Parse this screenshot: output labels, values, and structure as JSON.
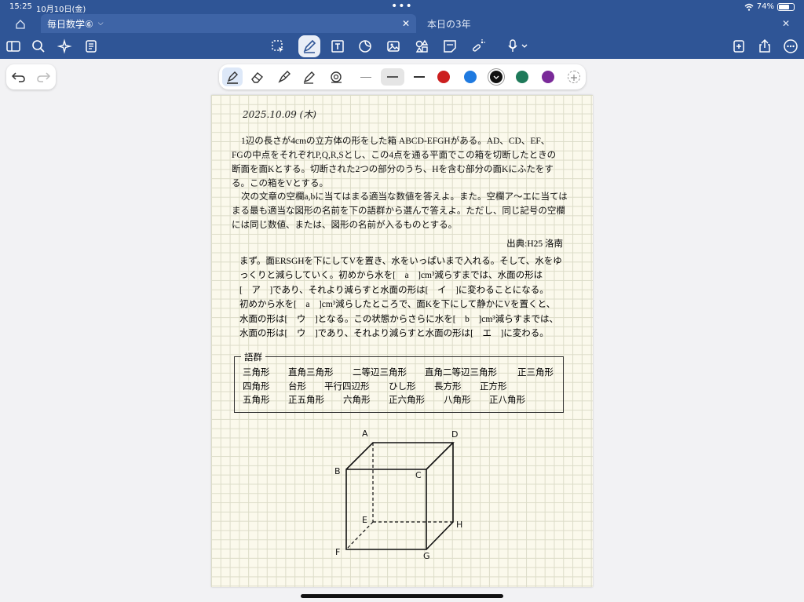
{
  "status": {
    "time": "15:25",
    "date": "10月10日(金)",
    "battery": "74%",
    "battery_level": 0.74
  },
  "tabs": [
    {
      "label": "毎日数学⑥",
      "active": true
    },
    {
      "label": "本日の3年",
      "active": false
    }
  ],
  "toolbar": {
    "left": [
      "sidebar-icon",
      "search-icon",
      "sparkle-icon",
      "notes-icon"
    ],
    "center": [
      "lasso-icon",
      "pen-icon",
      "textbox-icon",
      "sticker-icon",
      "image-icon",
      "shapes-icon",
      "note-icon",
      "laser-icon",
      "mic-icon"
    ],
    "right": [
      "new-page-icon",
      "share-icon",
      "more-icon"
    ]
  },
  "pen_tray": {
    "colors": [
      "#cc1f1f",
      "#1f7ae0",
      "#111111",
      "#1f7a5a",
      "#7a2a99"
    ],
    "selected_color": "#111111"
  },
  "document": {
    "date": "2025.10.09 (木)",
    "problem": [
      "1辺の長さが4cmの立方体の形をした箱 ABCD-EFGHがある。AD、CD、EF、",
      "FGの中点をそれぞれP,Q,R,Sとし、この4点を通る平面でこの箱を切断したときの",
      "断面を面Kとする。切断された2つの部分のうち、Hを含む部分の面Kにふたをす",
      "る。この箱をVとする。",
      "次の文章の空欄a,bに当てはまる適当な数値を答えよ。また。空欄ア～エに当ては",
      "まる最も適当な図形の名前を下の語群から選んで答えよ。ただし、同じ記号の空欄",
      "には同じ数値、または、図形の名前が入るものとする。"
    ],
    "source": "出典:H25 洛南",
    "story": [
      "まず。面ERSGHを下にしてVを置き、水をいっぱいまで入れる。そして、水をゆ",
      "っくりと減らしていく。初めから水を[　a　]cm³減らすまでは、水面の形は",
      "[　ア　]であり、それより減らすと水面の形は[　イ　]に変わることになる。",
      "初めから水を[　a　]cm³減らしたところで、面Kを下にして静かにVを置くと、",
      "水面の形は[　ウ　]となる。この状態からさらに水を[　b　]cm³減らすまでは、",
      "水面の形は[　ウ　]であり、それより減らすと水面の形は[　エ　]に変わる。"
    ],
    "word_group_title": "語群",
    "words": [
      [
        "三角形",
        "直角三角形",
        "二等辺三角形",
        "直角二等辺三角形",
        "正三角形"
      ],
      [
        "四角形",
        "台形",
        "平行四辺形",
        "ひし形",
        "長方形",
        "正方形"
      ],
      [
        "五角形",
        "正五角形",
        "六角形",
        "正六角形",
        "八角形",
        "正八角形"
      ]
    ],
    "cube_labels": {
      "A": "A",
      "B": "B",
      "C": "C",
      "D": "D",
      "E": "E",
      "F": "F",
      "G": "G",
      "H": "H"
    }
  }
}
